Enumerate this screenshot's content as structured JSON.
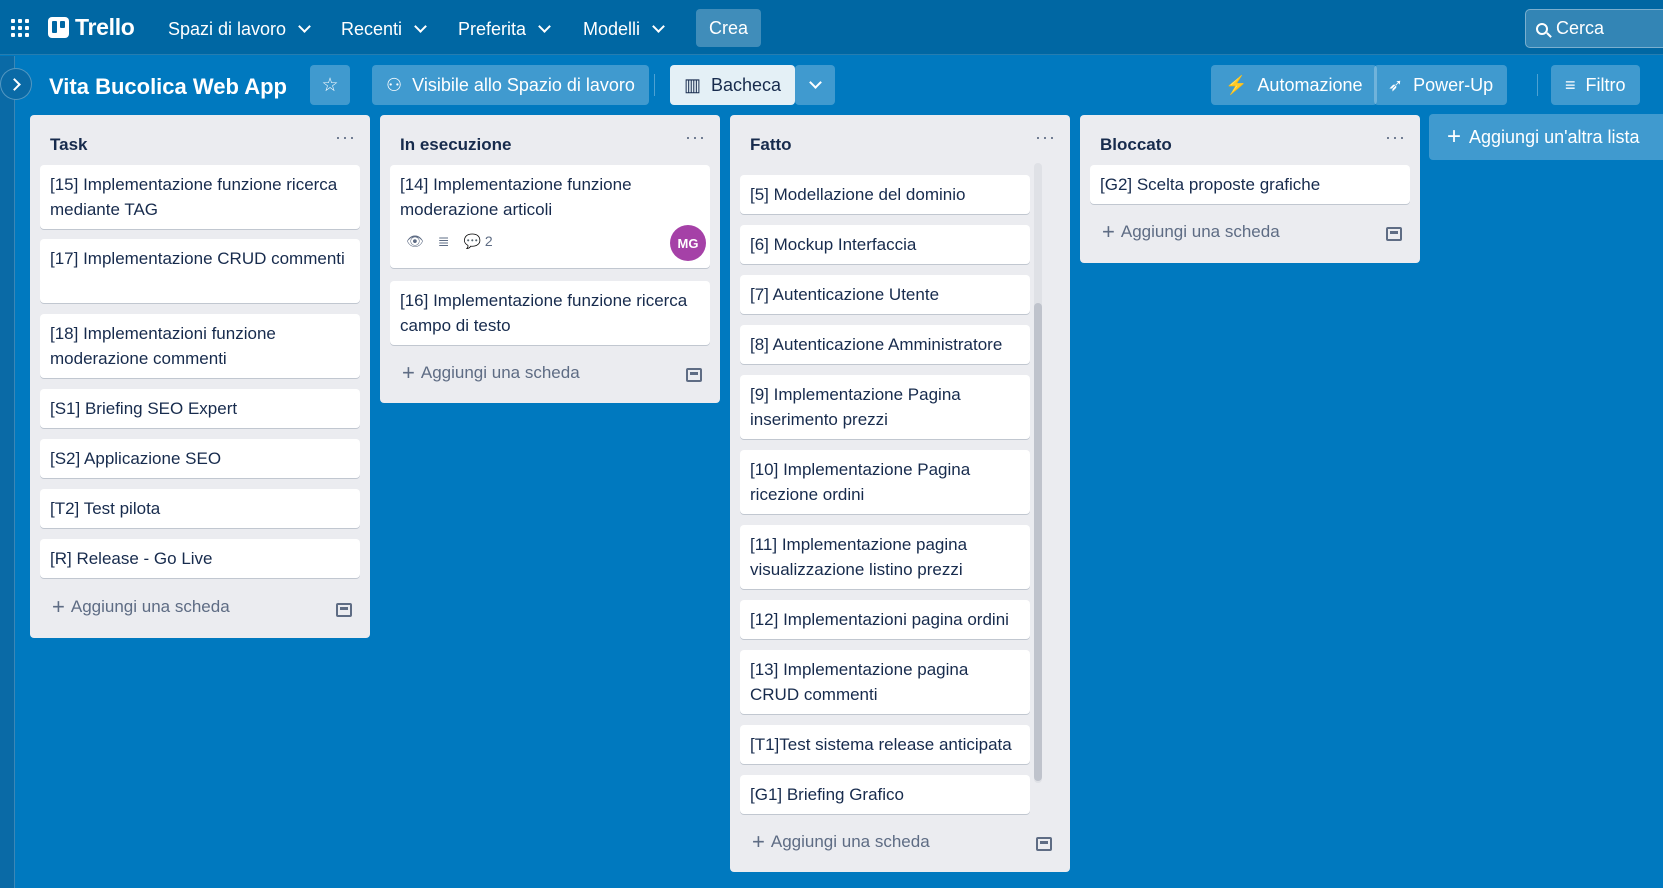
{
  "app": {
    "name": "Trello"
  },
  "nav": {
    "workspaces": "Spazi di lavoro",
    "recent": "Recenti",
    "starred": "Preferita",
    "templates": "Modelli",
    "create": "Crea",
    "search_placeholder": "Cerca"
  },
  "board": {
    "title": "Vita Bucolica Web App",
    "visibility": "Visibile allo Spazio di lavoro",
    "view": "Bacheca",
    "automation": "Automazione",
    "powerups": "Power-Up",
    "filter": "Filtro"
  },
  "lists": [
    {
      "title": "Task",
      "cards": [
        "[15] Implementazione funzione ricerca mediante TAG",
        "[17] Implementazione CRUD commenti",
        "[18] Implementazioni funzione moderazione commenti",
        "[S1] Briefing SEO Expert",
        "[S2] Applicazione SEO",
        "[T2] Test pilota",
        "[R] Release - Go Live"
      ],
      "add_card": "Aggiungi una scheda"
    },
    {
      "title": "In esecuzione",
      "cards": [
        "[14] Implementazione funzione moderazione articoli",
        "[16] Implementazione funzione ricerca campo di testo"
      ],
      "card_badges": {
        "comments": "2",
        "member": "MG"
      },
      "add_card": "Aggiungi una scheda"
    },
    {
      "title": "Fatto",
      "cards": [
        "[5] Modellazione del dominio",
        "[6] Mockup Interfaccia",
        "[7] Autenticazione Utente",
        "[8] Autenticazione Amministratore",
        "[9] Implementazione Pagina inserimento prezzi",
        "[10] Implementazione Pagina ricezione ordini",
        "[11] Implementazione pagina visualizzazione listino prezzi",
        "[12] Implementazioni pagina ordini",
        "[13] Implementazione pagina CRUD commenti",
        "[T1]Test sistema release anticipata",
        "[G1] Briefing Grafico"
      ],
      "add_card": "Aggiungi una scheda"
    },
    {
      "title": "Bloccato",
      "cards": [
        "[G2] Scelta proposte grafiche"
      ],
      "add_card": "Aggiungi una scheda"
    }
  ],
  "add_list": "Aggiungi un'altra lista",
  "colors": {
    "board_bg": "#0079bf",
    "avatar": "#a541a7"
  }
}
